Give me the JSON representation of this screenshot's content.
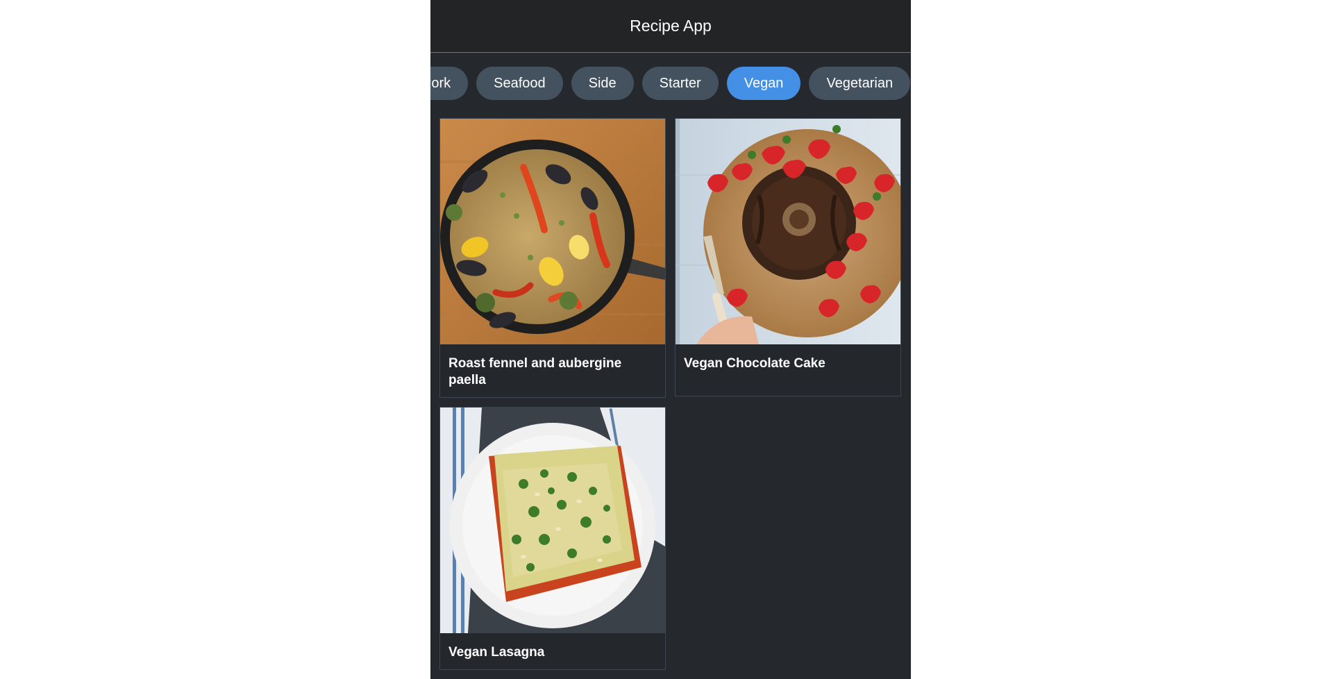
{
  "header": {
    "title": "Recipe App"
  },
  "categories": {
    "items": [
      {
        "label": "Pork",
        "active": false
      },
      {
        "label": "Seafood",
        "active": false
      },
      {
        "label": "Side",
        "active": false
      },
      {
        "label": "Starter",
        "active": false
      },
      {
        "label": "Vegan",
        "active": true
      },
      {
        "label": "Vegetarian",
        "active": false
      }
    ]
  },
  "recipes": [
    {
      "title": "Roast fennel and aubergine paella",
      "image": "paella-photo"
    },
    {
      "title": "Vegan Chocolate Cake",
      "image": "chocolate-cake-photo"
    },
    {
      "title": "Vegan Lasagna",
      "image": "lasagna-photo"
    }
  ],
  "colors": {
    "app_bg": "#25282d",
    "header_bg": "#222426",
    "pill_bg": "#44515e",
    "pill_active": "#4390e6",
    "card_border": "#3e4650"
  }
}
